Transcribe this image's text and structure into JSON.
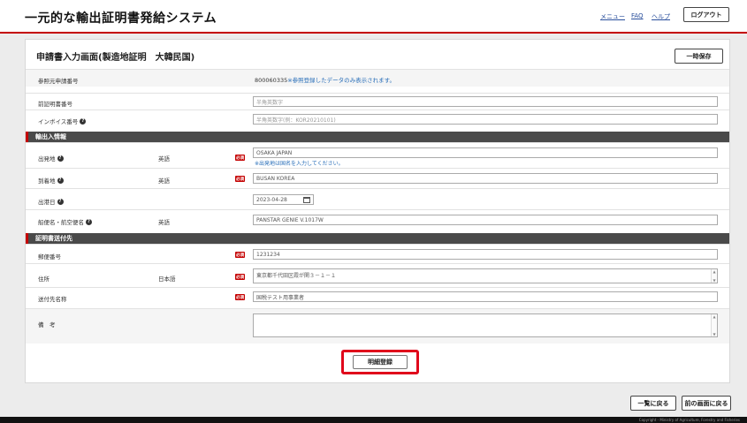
{
  "header": {
    "title": "一元的な輸出証明書発給システム",
    "menu_label": "メニュー",
    "faq_label": "FAQ",
    "help_label": "ヘルプ",
    "logout_label": "ログアウト"
  },
  "form": {
    "title": "申請書入力画面(製造地証明　大韓民国)",
    "save_label": "一時保存",
    "required_badge": "必須",
    "help_icon": "?",
    "ref_app_no": {
      "label": "参照元申請番号",
      "value": "800060335",
      "hint": "※参照登録したデータのみ表示されます。"
    },
    "prev_cert_no": {
      "label": "前証明書番号",
      "placeholder": "半角英数字"
    },
    "invoice_no": {
      "label": "インボイス番号",
      "placeholder": "半角英数字(例：KOR20210101)"
    },
    "section_export": "輸出入情報",
    "origin": {
      "label": "出発地",
      "lang": "英語",
      "value": "OSAKA JAPAN",
      "note": "※出発地は国名を入力してください。"
    },
    "destination": {
      "label": "到着地",
      "lang": "英語",
      "value": "BUSAN KOREA"
    },
    "departure_date": {
      "label": "出港日",
      "value": "2023-04-28"
    },
    "vessel": {
      "label": "船便名・航空便名",
      "lang": "英語",
      "value": "PANSTAR GENIE V.1017W"
    },
    "section_delivery": "証明書送付先",
    "postal_code": {
      "label": "郵便番号",
      "value": "1231234"
    },
    "address": {
      "label": "住所",
      "lang": "日本語",
      "value": "東京都千代田区霞が関３－１－１"
    },
    "recipient": {
      "label": "送付先名称",
      "value": "国税テスト用事業者"
    },
    "remarks": {
      "label": "備　考",
      "value": ""
    },
    "detail_register_label": "明細登録"
  },
  "footer_buttons": {
    "back_to_list": "一覧に戻る",
    "back_previous": "前の画面に戻る"
  },
  "footer_text": "Copyright - Ministry of Agriculture, Forestry and Fisheries"
}
